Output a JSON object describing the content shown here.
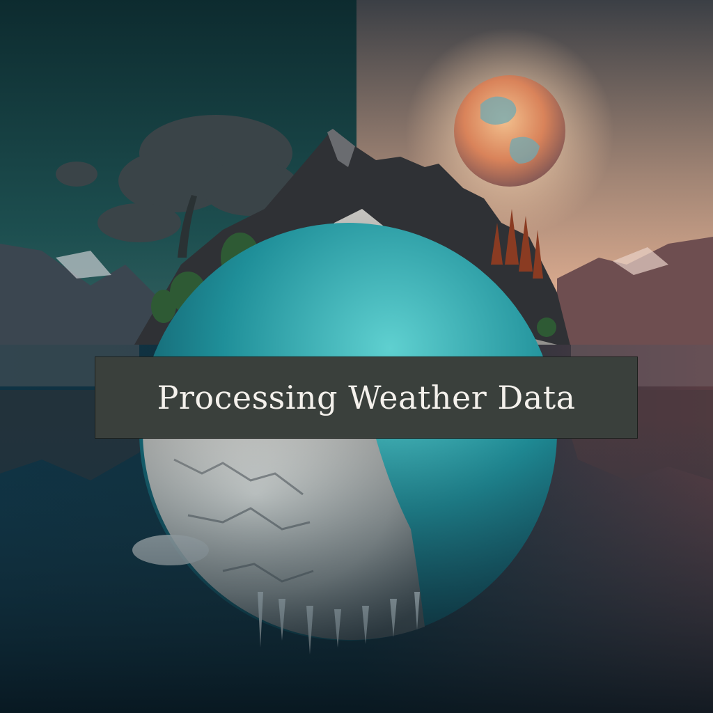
{
  "caption": {
    "text": "Processing Weather Data"
  },
  "colors": {
    "sky_left": "#123a3c",
    "sky_right": "#c7a08a",
    "water_left": "#123848",
    "water_right": "#6a4a4e",
    "planet": "#d98a5c",
    "ocean_globe": "#2fa3a8",
    "ice": "#dcdcd8",
    "banner": "#3a403c",
    "banner_text": "#f4f1ec"
  },
  "image": {
    "subject": "split mountain island with moon and frozen globe reflection",
    "left_half": "night teal sky with dark storm cloud tree",
    "right_half": "warm sunset sky with rising planet and autumn trees"
  }
}
